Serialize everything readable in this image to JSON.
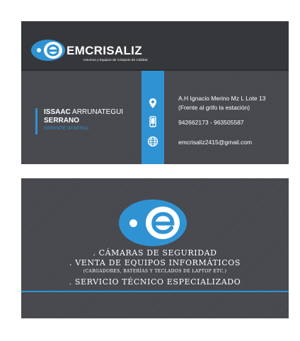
{
  "colors": {
    "accent": "#2f93d3",
    "card": "#46484d",
    "header": "#36373b",
    "text": "#ffffff"
  },
  "front": {
    "brand": "EMCRISALIZ",
    "tagline": "Insumos y Equipos de Cómputo de Calidad",
    "name_first": "ISSAAC",
    "name_rest": " ARRUNATEGUI",
    "name_line2": "SERRANO",
    "role": "GERENTE GENERAL",
    "address_line1": "A.H Ignacio Merino Mz L Lote 13",
    "address_line2": "(Frente al grifo la estación)",
    "phones": "942662173 - 963505587",
    "email": "emcrisaliz2415@gmail.com",
    "icons": [
      "location-pin-icon",
      "phone-icon",
      "globe-icon"
    ]
  },
  "back": {
    "services": [
      ". CÁMARAS DE SEGURIDAD",
      ". VENTA DE EQUIPOS INFORMÁTICOS",
      "(CARGADORES, BATERÍAS Y TECLADOS DE LAPTOP ETC.)",
      ". SERVICIO TÉCNICO ESPECIALIZADO"
    ]
  }
}
